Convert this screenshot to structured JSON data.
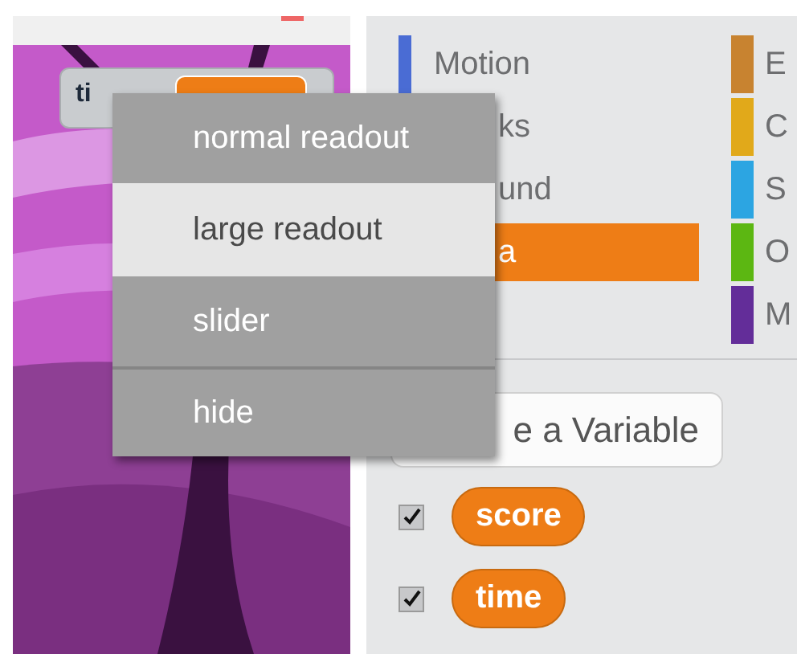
{
  "stage": {
    "monitor": {
      "label": "ti"
    }
  },
  "palette": {
    "categories": [
      {
        "label": "Motion",
        "color": "#4a6cd4",
        "selected": false
      },
      {
        "label": "ks",
        "selected": false
      },
      {
        "label": "und",
        "selected": false
      },
      {
        "label": "a",
        "color": "#ee7d16",
        "selected": true
      }
    ],
    "categories_right": [
      {
        "label": "E",
        "color": "#c88330",
        "selected": false
      },
      {
        "label": "C",
        "color": "#e1a91a",
        "selected": false
      },
      {
        "label": "S",
        "color": "#2ca5e2",
        "selected": false
      },
      {
        "label": "O",
        "color": "#5cb712",
        "selected": false
      },
      {
        "label": "M",
        "color": "#632d99",
        "selected": false
      }
    ],
    "make_variable_button": "e a Variable",
    "variables": [
      {
        "name": "score",
        "checked": true
      },
      {
        "name": "time",
        "checked": true
      }
    ]
  },
  "context_menu": {
    "items": [
      {
        "label": "normal readout",
        "selected": false
      },
      {
        "label": "large readout",
        "selected": true
      },
      {
        "label": "slider",
        "selected": false
      },
      {
        "label": "hide",
        "selected": false
      }
    ]
  }
}
